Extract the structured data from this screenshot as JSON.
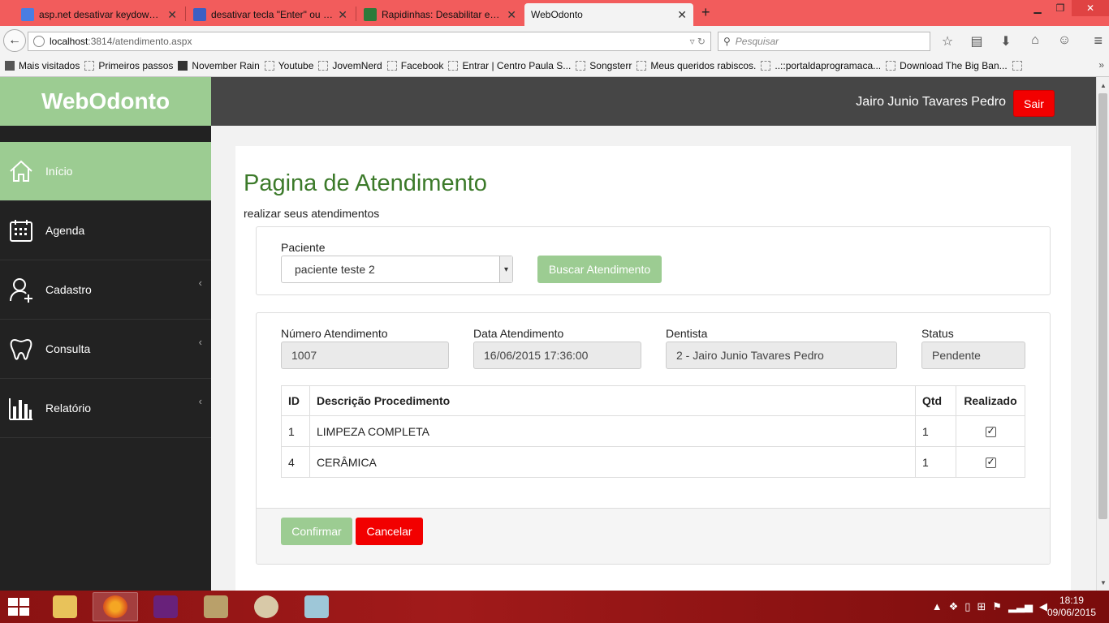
{
  "browser": {
    "tabs": [
      {
        "title": "asp.net desativar keydown ...",
        "active": false
      },
      {
        "title": "desativar tecla \"Enter\" ou d...",
        "active": false
      },
      {
        "title": "Rapidinhas: Desabilitar ent...",
        "active": false
      },
      {
        "title": "WebOdonto",
        "active": true
      }
    ],
    "new_tab": "+",
    "url_host": "localhost",
    "url_path": ":3814/atendimento.aspx",
    "search_placeholder": "Pesquisar",
    "bookmarks": [
      "Mais visitados",
      "Primeiros passos",
      "November Rain",
      "Youtube",
      "JovemNerd",
      "Facebook",
      "Entrar | Centro Paula S...",
      "Songsterr",
      "Meus queridos rabiscos.",
      "..::portaldaprogramaca...",
      "Download The Big Ban..."
    ]
  },
  "app": {
    "brand": "WebOdonto",
    "user_name": "Jairo Junio Tavares Pedro",
    "logout_label": "Sair",
    "accent_color": "#9ccc92",
    "danger_color": "#f20000"
  },
  "sidebar": {
    "items": [
      {
        "label": "Início",
        "icon": "home-icon",
        "active": true
      },
      {
        "label": "Agenda",
        "icon": "calendar-icon",
        "active": false
      },
      {
        "label": "Cadastro",
        "icon": "user-add-icon",
        "active": false
      },
      {
        "label": "Consulta",
        "icon": "tooth-icon",
        "active": false
      },
      {
        "label": "Relatório",
        "icon": "bar-chart-icon",
        "active": false
      }
    ],
    "chevron": "‹"
  },
  "page": {
    "title": "Pagina de Atendimento",
    "subtitle": "realizar seus atendimentos"
  },
  "search": {
    "patient_label": "Paciente",
    "patient_value": "paciente teste 2",
    "button_label": "Buscar Atendimento"
  },
  "attendance": {
    "number_label": "Número Atendimento",
    "number_value": "1007",
    "date_label": "Data Atendimento",
    "date_value": "16/06/2015 17:36:00",
    "dentist_label": "Dentista",
    "dentist_value": "2 - Jairo Junio Tavares Pedro",
    "status_label": "Status",
    "status_value": "Pendente"
  },
  "table": {
    "headers": [
      "ID",
      "Descrição Procedimento",
      "Qtd",
      "Realizado"
    ],
    "rows": [
      {
        "id": "1",
        "description": "LIMPEZA COMPLETA",
        "qty": "1",
        "done": true
      },
      {
        "id": "4",
        "description": "CERÂMICA",
        "qty": "1",
        "done": true
      }
    ]
  },
  "actions": {
    "confirm_label": "Confirmar",
    "cancel_label": "Cancelar"
  },
  "taskbar": {
    "time": "18:19",
    "date": "09/06/2015"
  }
}
